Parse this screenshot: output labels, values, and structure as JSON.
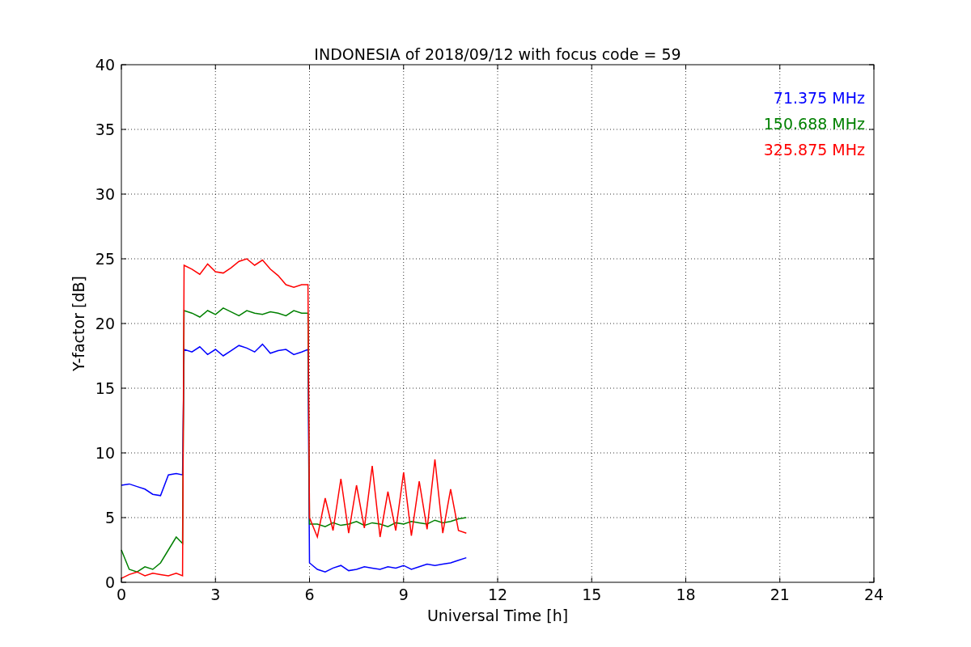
{
  "chart_data": {
    "type": "line",
    "title": "INDONESIA of 2018/09/12 with focus code = 59",
    "xlabel": "Universal Time [h]",
    "ylabel": "Y-factor [dB]",
    "xlim": [
      0,
      24
    ],
    "ylim": [
      0,
      40
    ],
    "xticks": [
      0,
      3,
      6,
      9,
      12,
      15,
      18,
      21,
      24
    ],
    "yticks": [
      0,
      5,
      10,
      15,
      20,
      25,
      30,
      35,
      40
    ],
    "grid": true,
    "x": [
      0,
      0.25,
      0.5,
      0.75,
      1,
      1.25,
      1.5,
      1.75,
      1.95,
      2,
      2.25,
      2.5,
      2.75,
      3,
      3.25,
      3.5,
      3.75,
      4,
      4.25,
      4.5,
      4.75,
      5,
      5.25,
      5.5,
      5.75,
      5.95,
      6,
      6.25,
      6.5,
      6.75,
      7,
      7.25,
      7.5,
      7.75,
      8,
      8.25,
      8.5,
      8.75,
      9,
      9.25,
      9.5,
      9.75,
      10,
      10.25,
      10.5,
      10.75,
      11
    ],
    "series": [
      {
        "name": "71.375 MHz",
        "color": "#0000ff",
        "values": [
          7.5,
          7.6,
          7.4,
          7.2,
          6.8,
          6.7,
          8.3,
          8.4,
          8.3,
          18,
          17.8,
          18.2,
          17.6,
          18.0,
          17.5,
          17.9,
          18.3,
          18.1,
          17.8,
          18.4,
          17.7,
          17.9,
          18.0,
          17.6,
          17.8,
          18.0,
          1.5,
          1.0,
          0.8,
          1.1,
          1.3,
          0.9,
          1.0,
          1.2,
          1.1,
          1.0,
          1.2,
          1.1,
          1.3,
          1.0,
          1.2,
          1.4,
          1.3,
          1.4,
          1.5,
          1.7,
          1.9
        ]
      },
      {
        "name": "150.688 MHz",
        "color": "#008000",
        "values": [
          2.5,
          1.0,
          0.8,
          1.2,
          1.0,
          1.5,
          2.5,
          3.5,
          3.0,
          21,
          20.8,
          20.5,
          21.0,
          20.7,
          21.2,
          20.9,
          20.6,
          21.0,
          20.8,
          20.7,
          20.9,
          20.8,
          20.6,
          21.0,
          20.8,
          20.8,
          4.5,
          4.5,
          4.3,
          4.6,
          4.4,
          4.5,
          4.7,
          4.4,
          4.6,
          4.5,
          4.3,
          4.6,
          4.5,
          4.7,
          4.6,
          4.5,
          4.8,
          4.6,
          4.7,
          4.9,
          5.0
        ]
      },
      {
        "name": "325.875 MHz",
        "color": "#ff0000",
        "values": [
          0.3,
          0.6,
          0.8,
          0.5,
          0.7,
          0.6,
          0.5,
          0.7,
          0.5,
          24.5,
          24.2,
          23.8,
          24.6,
          24.0,
          23.9,
          24.3,
          24.8,
          25.0,
          24.5,
          24.9,
          24.2,
          23.7,
          23.0,
          22.8,
          23.0,
          23.0,
          5.0,
          3.5,
          6.5,
          4.0,
          8.0,
          3.8,
          7.5,
          4.2,
          9.0,
          3.5,
          7.0,
          4.0,
          8.5,
          3.6,
          7.8,
          4.1,
          9.5,
          3.8,
          7.2,
          4.0,
          3.8
        ]
      }
    ]
  }
}
